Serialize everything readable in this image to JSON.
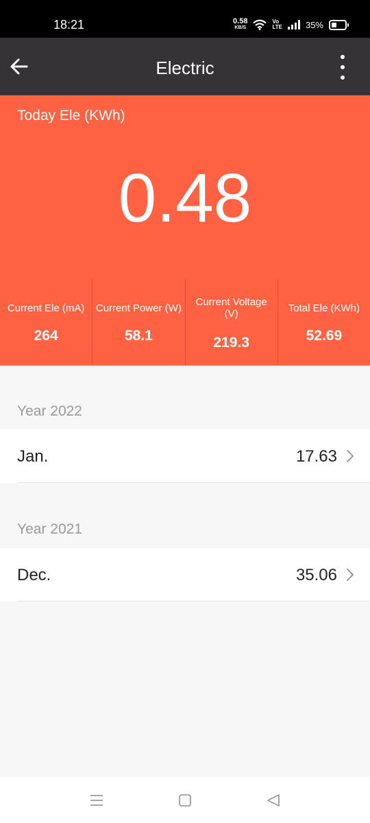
{
  "status": {
    "time": "18:21",
    "net_speed": "0.58",
    "net_unit": "KB/S",
    "volte_top": "Vo",
    "volte_bottom": "LTE",
    "battery": "35%"
  },
  "app_bar": {
    "title": "Electric",
    "back_icon": "arrow-left-icon",
    "more_icon": "more-vertical-icon"
  },
  "today": {
    "label": "Today Ele (KWh)",
    "value": "0.48"
  },
  "metrics": [
    {
      "label": "Current Ele (mA)",
      "value": "264"
    },
    {
      "label": "Current Power (W)",
      "value": "58.1"
    },
    {
      "label": "Current Voltage (V)",
      "value": "219.3"
    },
    {
      "label": "Total Ele (KWh)",
      "value": "52.69"
    }
  ],
  "history": [
    {
      "year": "Year 2022",
      "months": [
        {
          "name": "Jan.",
          "value": "17.63"
        }
      ]
    },
    {
      "year": "Year 2021",
      "months": [
        {
          "name": "Dec.",
          "value": "35.06"
        }
      ]
    }
  ],
  "nav": {
    "menu_icon": "menu-icon",
    "home_icon": "home-square-icon",
    "back_icon": "back-triangle-icon"
  },
  "colors": {
    "accent": "#ff6243",
    "app_bar": "#353336",
    "background": "#f7f7f7"
  }
}
